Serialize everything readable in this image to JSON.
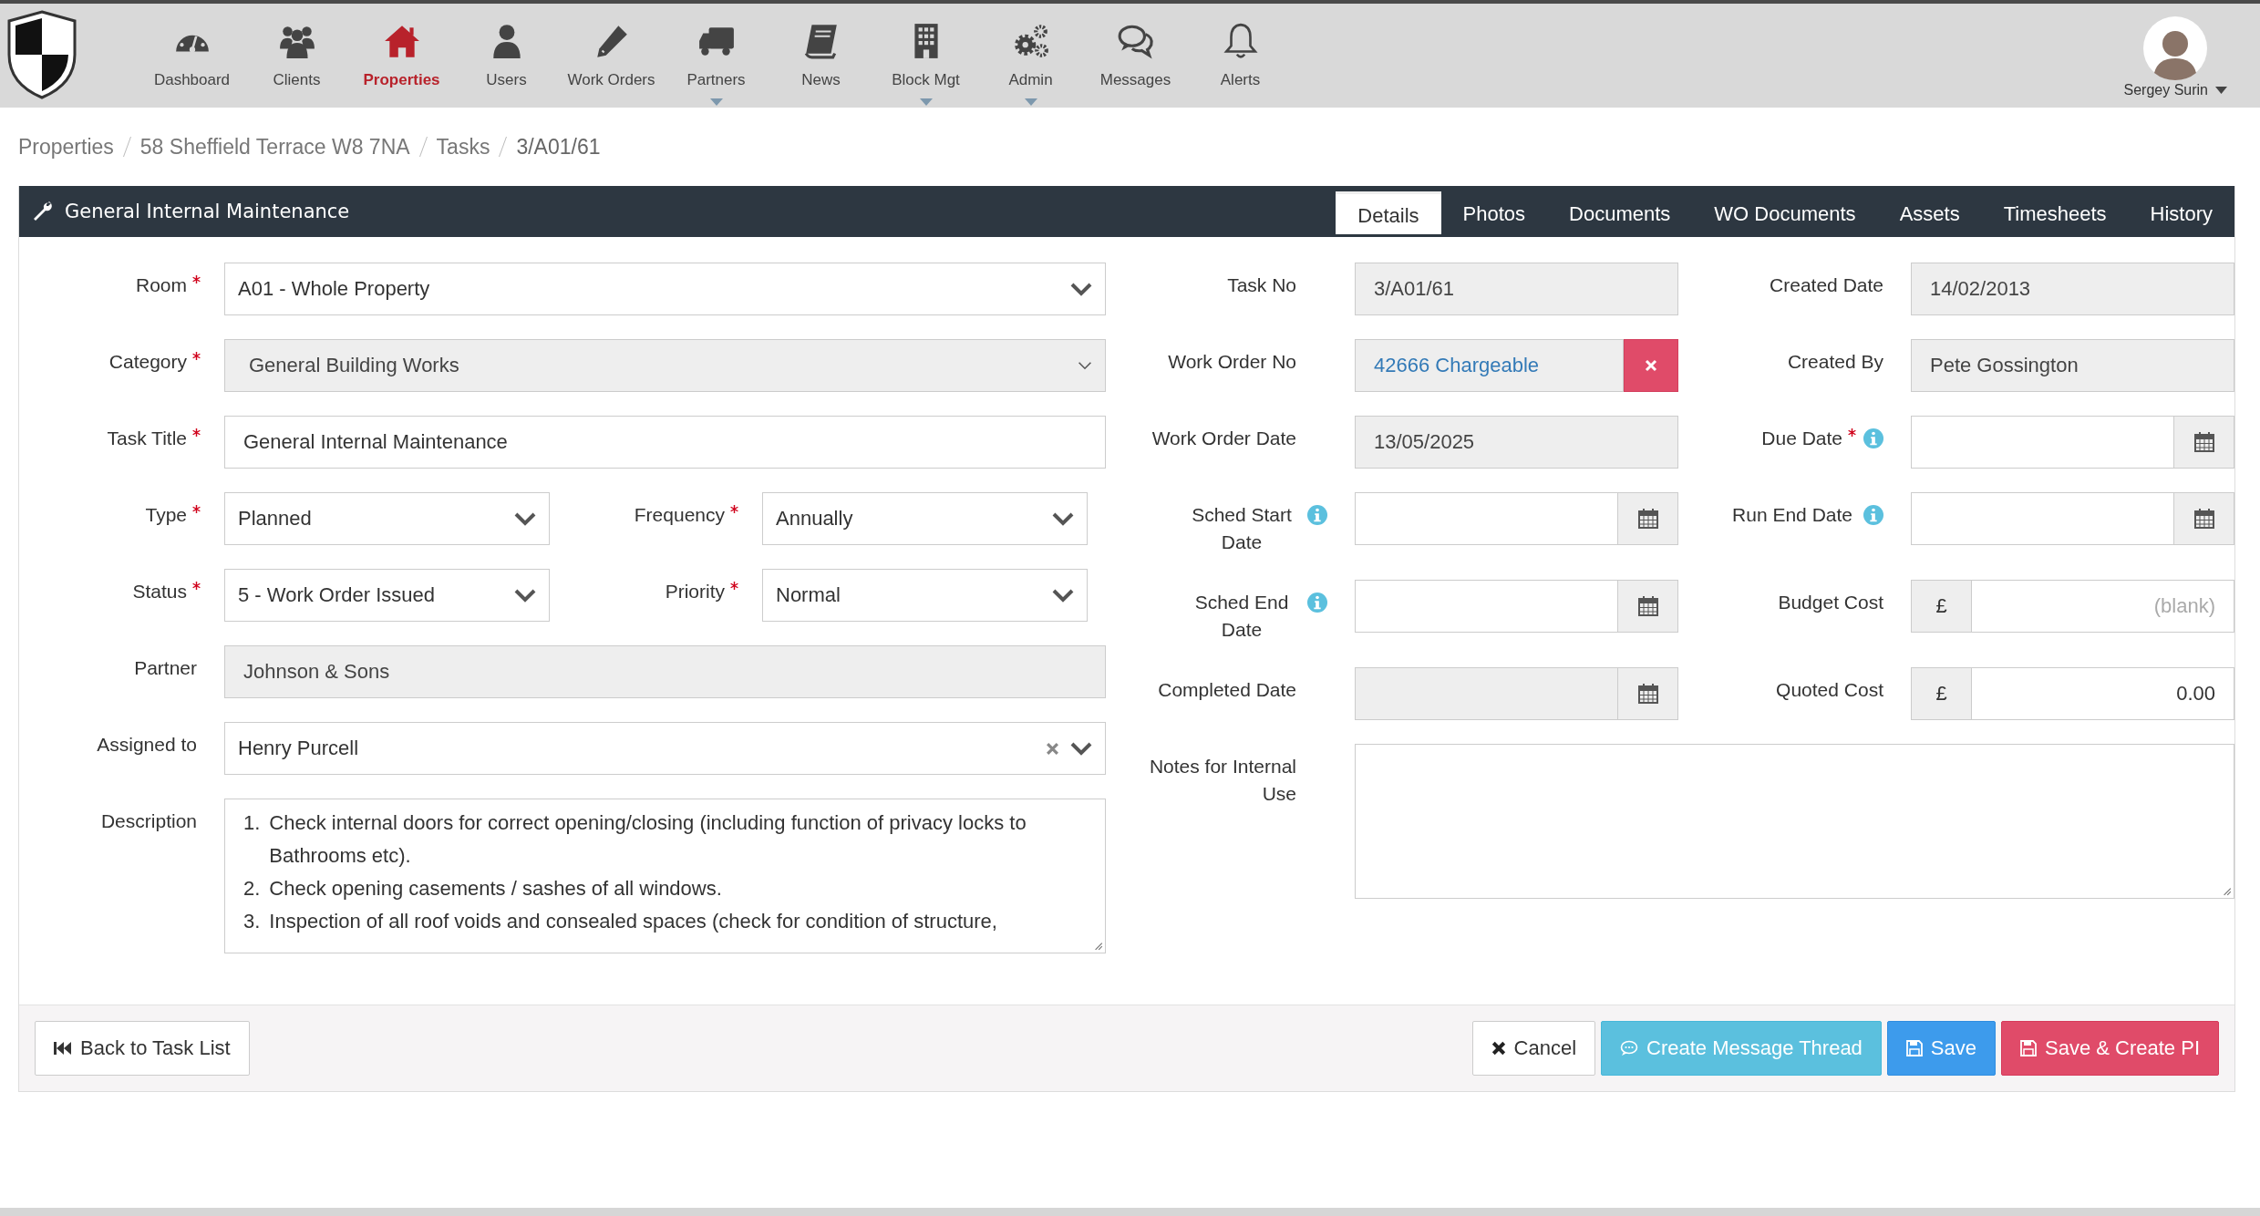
{
  "nav": {
    "items": [
      {
        "label": "Dashboard",
        "selected": false,
        "has_menu": false
      },
      {
        "label": "Clients",
        "selected": false,
        "has_menu": false
      },
      {
        "label": "Properties",
        "selected": true,
        "has_menu": false
      },
      {
        "label": "Users",
        "selected": false,
        "has_menu": false
      },
      {
        "label": "Work Orders",
        "selected": false,
        "has_menu": false
      },
      {
        "label": "Partners",
        "selected": false,
        "has_menu": true
      },
      {
        "label": "News",
        "selected": false,
        "has_menu": false
      },
      {
        "label": "Block Mgt",
        "selected": false,
        "has_menu": true
      },
      {
        "label": "Admin",
        "selected": false,
        "has_menu": true
      },
      {
        "label": "Messages",
        "selected": false,
        "has_menu": false
      },
      {
        "label": "Alerts",
        "selected": false,
        "has_menu": false
      }
    ],
    "user": {
      "name": "Sergey Surin"
    }
  },
  "breadcrumb": [
    "Properties",
    "58 Sheffield Terrace W8 7NA",
    "Tasks",
    "3/A01/61"
  ],
  "panel": {
    "title": "General Internal Maintenance",
    "tabs": [
      {
        "label": "Details",
        "selected": true
      },
      {
        "label": "Photos",
        "selected": false
      },
      {
        "label": "Documents",
        "selected": false
      },
      {
        "label": "WO Documents",
        "selected": false
      },
      {
        "label": "Assets",
        "selected": false
      },
      {
        "label": "Timesheets",
        "selected": false
      },
      {
        "label": "History",
        "selected": false
      }
    ]
  },
  "left": {
    "rows": [
      {
        "fields": [
          {
            "label": "Room",
            "required": true,
            "kind": "select",
            "value": "A01 - Whole Property",
            "disabled": false
          }
        ]
      },
      {
        "fields": [
          {
            "label": "Category",
            "required": true,
            "kind": "select",
            "value": "General Building Works",
            "disabled": true
          }
        ]
      },
      {
        "fields": [
          {
            "label": "Task Title",
            "required": true,
            "kind": "text",
            "value": "General Internal Maintenance",
            "disabled": false
          }
        ]
      },
      {
        "fields": [
          {
            "label": "Type",
            "required": true,
            "kind": "select",
            "value": "Planned",
            "disabled": false
          },
          {
            "label": "Frequency",
            "required": true,
            "kind": "select",
            "value": "Annually",
            "disabled": false
          }
        ]
      },
      {
        "fields": [
          {
            "label": "Status",
            "required": true,
            "kind": "select",
            "value": "5 - Work Order Issued",
            "disabled": false
          },
          {
            "label": "Priority",
            "required": true,
            "kind": "select",
            "value": "Normal",
            "disabled": false
          }
        ]
      },
      {
        "fields": [
          {
            "label": "Partner",
            "required": false,
            "kind": "text",
            "value": "Johnson & Sons",
            "disabled": true
          }
        ]
      },
      {
        "fields": [
          {
            "label": "Assigned to",
            "required": false,
            "kind": "clearable",
            "value": "Henry Purcell",
            "disabled": false
          }
        ]
      },
      {
        "fields": [
          {
            "label": "Description",
            "required": false,
            "kind": "list",
            "items": [
              {
                "number": "1.",
                "text": "Check internal doors for correct opening/closing (including function of privacy locks to Bathrooms etc)."
              },
              {
                "number": "2.",
                "text": "Check opening casements / sashes of all windows."
              },
              {
                "number": "3.",
                "text": "Inspection of all roof voids and consealed spaces (check for condition of structure,"
              }
            ]
          }
        ]
      }
    ]
  },
  "right": {
    "rows": [
      {
        "fields": [
          {
            "label": "Task No",
            "required": false,
            "info": false,
            "kind": "text",
            "value": "3/A01/61",
            "disabled": true
          },
          {
            "label": "Created Date",
            "required": false,
            "info": false,
            "kind": "text",
            "value": "14/02/2013",
            "disabled": true
          }
        ]
      },
      {
        "fields": [
          {
            "label": "Work Order No",
            "required": false,
            "info": false,
            "kind": "link",
            "value": "42666 Chargeable"
          },
          {
            "label": "Created By",
            "required": false,
            "info": false,
            "kind": "text",
            "value": "Pete Gossington",
            "disabled": true
          }
        ]
      },
      {
        "fields": [
          {
            "label": "Work Order Date",
            "required": false,
            "info": false,
            "kind": "text",
            "value": "13/05/2025",
            "disabled": true
          },
          {
            "label": "Due Date",
            "required": true,
            "info": true,
            "kind": "date",
            "disabled": false
          }
        ]
      },
      {
        "fields": [
          {
            "label": "Sched Start Date",
            "required": false,
            "info": true,
            "kind": "date",
            "disabled": false
          },
          {
            "label": "Run End Date",
            "required": false,
            "info": true,
            "kind": "date",
            "disabled": false
          }
        ]
      },
      {
        "fields": [
          {
            "label": "Sched End Date",
            "required": false,
            "info": true,
            "kind": "date",
            "disabled": false
          },
          {
            "label": "Budget Cost",
            "required": false,
            "info": false,
            "kind": "money",
            "currency": "£",
            "placeholder": "(blank)"
          }
        ]
      },
      {
        "fields": [
          {
            "label": "Completed Date",
            "required": false,
            "info": false,
            "kind": "date",
            "disabled": true
          },
          {
            "label": "Quoted Cost",
            "required": false,
            "info": false,
            "kind": "money",
            "currency": "£",
            "value": "0.00"
          }
        ]
      },
      {
        "fields": [
          {
            "label": "Notes for Internal Use",
            "required": false,
            "info": false,
            "kind": "notes"
          }
        ]
      }
    ]
  },
  "buttons": [
    {
      "label": "Back to Task List",
      "kind": "back"
    },
    {
      "label": "Cancel",
      "kind": "cancel"
    },
    {
      "label": "Create Message Thread",
      "kind": "message"
    },
    {
      "label": "Save",
      "kind": "save"
    },
    {
      "label": "Save & Create PI",
      "kind": "save_pi"
    }
  ]
}
